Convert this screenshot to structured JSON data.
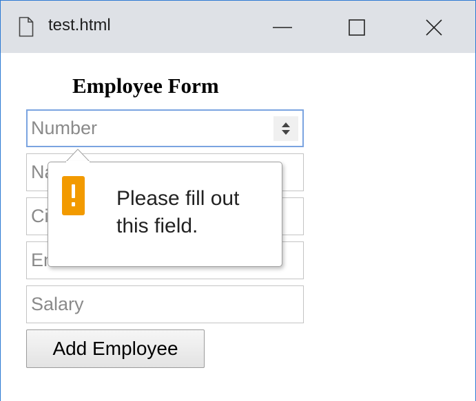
{
  "window": {
    "tab_title": "test.html",
    "icons": {
      "document": "document-icon",
      "minimize": "minimize-icon",
      "maximize": "maximize-icon",
      "close": "close-icon"
    }
  },
  "form": {
    "title": "Employee Form",
    "fields": {
      "number_placeholder": "Number",
      "name_placeholder": "Name",
      "city_placeholder": "City",
      "email_placeholder": "Email",
      "salary_placeholder": "Salary"
    },
    "submit_label": "Add Employee"
  },
  "validation": {
    "message": "Please fill out this field.",
    "icon": "warning-icon",
    "icon_color": "#f29a00"
  },
  "colors": {
    "titlebar": "#dee1e6",
    "focus_border": "#7aa3e0",
    "window_border": "#2b79d3"
  }
}
